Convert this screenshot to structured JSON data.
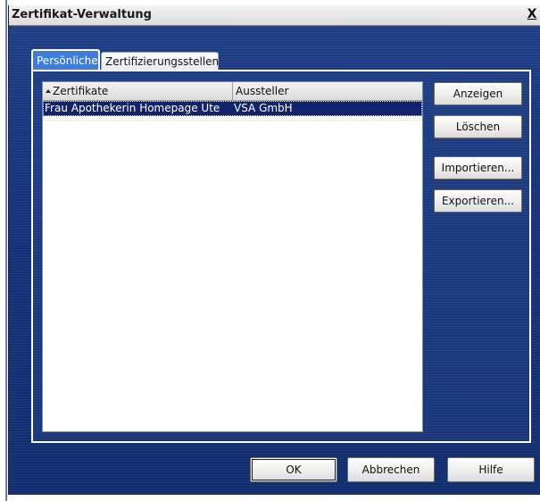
{
  "window": {
    "title": "Zertifikat-Verwaltung",
    "close_label": "X"
  },
  "tabs": [
    {
      "label": "Persönliche",
      "selected": true
    },
    {
      "label": "Zertifizierungsstellen",
      "selected": false
    }
  ],
  "list": {
    "columns": [
      {
        "label": "Zertifikate",
        "sorted": "ascending"
      },
      {
        "label": "Aussteller"
      }
    ],
    "rows": [
      {
        "name": "Frau Apothekerin Homepage Ute",
        "issuer": "VSA GmbH",
        "selected": true
      }
    ]
  },
  "side_buttons": {
    "view": "Anzeigen",
    "delete": "Löschen",
    "import": "Importieren...",
    "export": "Exportieren..."
  },
  "bottom_buttons": {
    "ok": "OK",
    "cancel": "Abbrechen",
    "help": "Hilfe"
  },
  "colors": {
    "window_bg": "#15327a",
    "selection": "#10236b",
    "active_tab": "#3e7ed9"
  },
  "icons": {
    "sort": "sort-ascending-icon"
  }
}
